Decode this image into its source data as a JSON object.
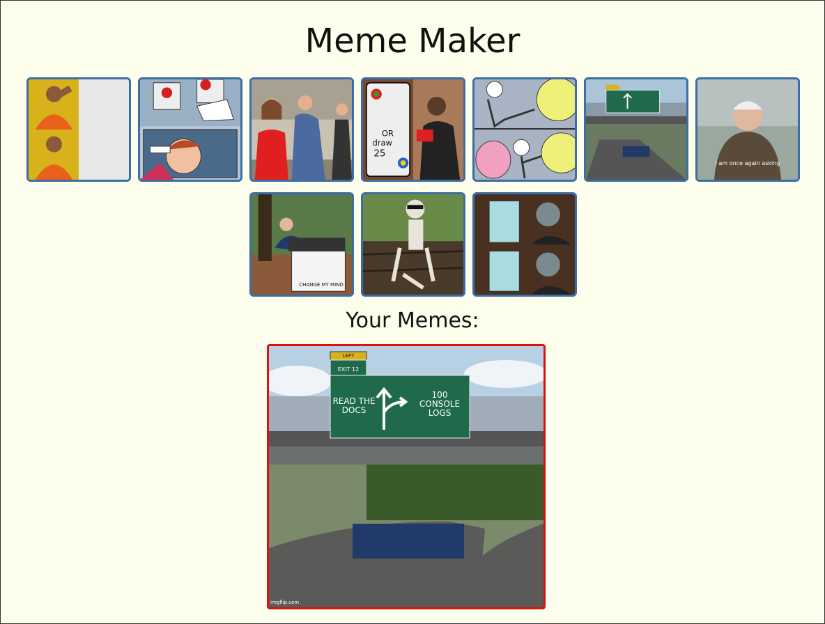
{
  "header": {
    "title": "Meme Maker"
  },
  "templates": [
    {
      "name": "drake-hotline-bling"
    },
    {
      "name": "two-buttons"
    },
    {
      "name": "distracted-boyfriend"
    },
    {
      "name": "uno-draw-25",
      "card_text_1": "OR",
      "card_text_2": "draw",
      "card_text_3": "25"
    },
    {
      "name": "epic-handshake-ball"
    },
    {
      "name": "left-exit-12"
    },
    {
      "name": "bernie-asking",
      "caption": "I am once again asking"
    },
    {
      "name": "change-my-mind",
      "sign_text": "CHANGE MY MIND"
    },
    {
      "name": "waiting-skeleton"
    },
    {
      "name": "gru-plan"
    }
  ],
  "memes_section": {
    "heading": "Your Memes:"
  },
  "your_meme": {
    "template": "left-exit-12",
    "sign_top": "LEFT",
    "sign_exit": "EXIT 12",
    "left_text": "READ THE DOCS",
    "right_text": "100 CONSOLE LOGS",
    "watermark": "imgflip.com"
  }
}
